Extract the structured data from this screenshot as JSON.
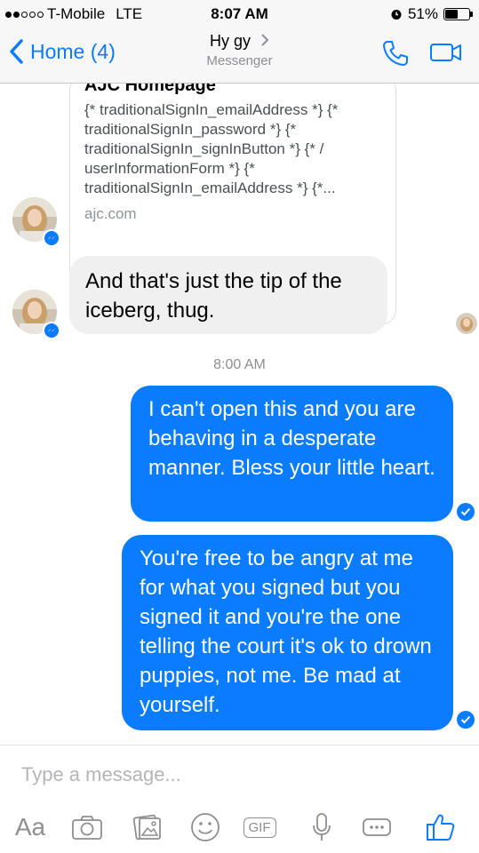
{
  "status_bar": {
    "carrier": "T-Mobile",
    "network": "LTE",
    "time": "8:07 AM",
    "battery": "51%",
    "battery_level": 0.51
  },
  "nav": {
    "back_label": "Home (4)",
    "title": "Hy gy",
    "subtitle": "Messenger",
    "icons": [
      "chevron-left-icon",
      "chevron-right-icon",
      "phone-icon",
      "video-camera-icon"
    ]
  },
  "chat": {
    "link_card": {
      "title": "AJC Homepage",
      "description": "{* traditionalSignIn_emailAddress *} {* traditionalSignIn_password *} {* traditionalSignIn_signInButton *} {* / userInformationForm *} {* traditionalSignIn_emailAddress *} {*...",
      "domain": "ajc.com"
    },
    "incoming_message": "And that's just the tip of the iceberg, thug.",
    "timestamp": "8:00 AM",
    "outgoing_messages": [
      "I can't open this and you are behaving in a desperate manner. Bless your little heart.",
      "You're free to be angry at me for what you signed but you signed it and you're the one telling the court it's ok to drown puppies, not me. Be mad at yourself."
    ]
  },
  "composer": {
    "placeholder": "Type a message...",
    "aa_label": "Aa",
    "gif_label": "GIF",
    "tools": [
      "text-format-icon",
      "camera-icon",
      "photo-gallery-icon",
      "emoji-icon",
      "gif-icon",
      "microphone-icon",
      "more-icon",
      "thumbs-up-icon"
    ]
  },
  "colors": {
    "accent": "#0a7cff",
    "incoming_bubble": "#f1f0f0",
    "muted": "#8e8e93"
  }
}
